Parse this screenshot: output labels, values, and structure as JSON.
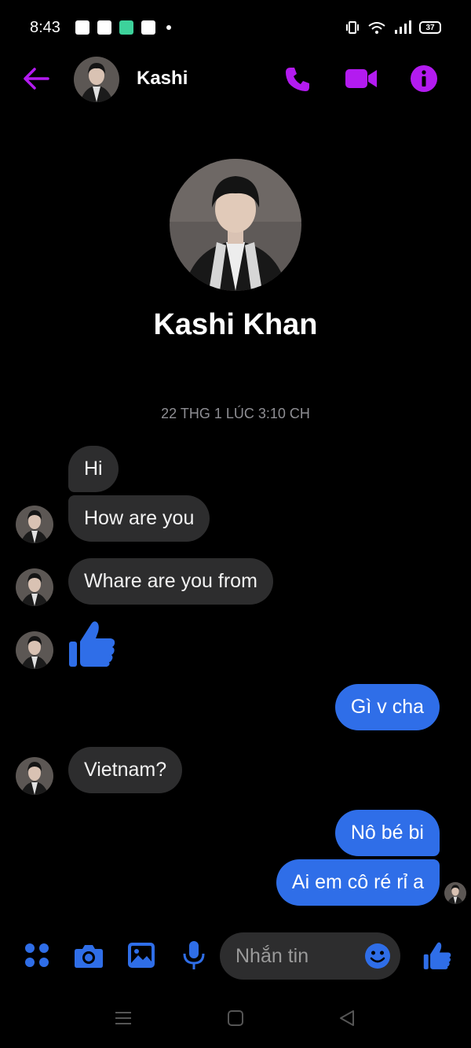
{
  "status_bar": {
    "time": "8:43",
    "battery": "37"
  },
  "header": {
    "name": "Kashi"
  },
  "profile": {
    "full_name": "Kashi Khan"
  },
  "timestamp": "22 THG 1 LÚC 3:10 CH",
  "messages": [
    {
      "from": "them",
      "text": "Hi"
    },
    {
      "from": "them",
      "text": "How are you"
    },
    {
      "from": "them",
      "text": "Whare are you from"
    },
    {
      "from": "them",
      "type": "like"
    },
    {
      "from": "me",
      "text": "Gì v cha"
    },
    {
      "from": "them",
      "text": "Vietnam?"
    },
    {
      "from": "me",
      "text": "Nô bé bi"
    },
    {
      "from": "me",
      "text": "Ai em cô ré rỉ a"
    }
  ],
  "composer": {
    "placeholder": "Nhắn tin"
  },
  "colors": {
    "accent": "#a020f0",
    "blue": "#2f6ee8",
    "incoming": "#2d2d2e",
    "background": "#000000"
  },
  "icons": [
    "back-arrow-icon",
    "phone-icon",
    "video-camera-icon",
    "info-icon",
    "apps-icon",
    "camera-icon",
    "gallery-icon",
    "microphone-icon",
    "emoji-icon",
    "thumbs-up-icon"
  ]
}
